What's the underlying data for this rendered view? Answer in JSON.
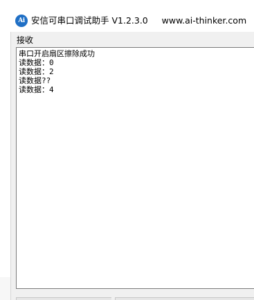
{
  "window": {
    "icon_text": "Ai",
    "title": "安信可串口调试助手 V1.2.3.0     www.ai-thinker.com"
  },
  "receive": {
    "group_label": "接收",
    "lines": [
      "串口开启扇区擦除成功",
      "读数据：0",
      "读数据：2",
      "读数据??",
      "读数据：4"
    ]
  },
  "colors": {
    "title_bg": "#ffffff",
    "client_bg": "#f0f0f0",
    "text_box_bg": "#ffffff",
    "text_box_border": "#7a7a7a",
    "icon_bg": "#1f6fc5"
  }
}
